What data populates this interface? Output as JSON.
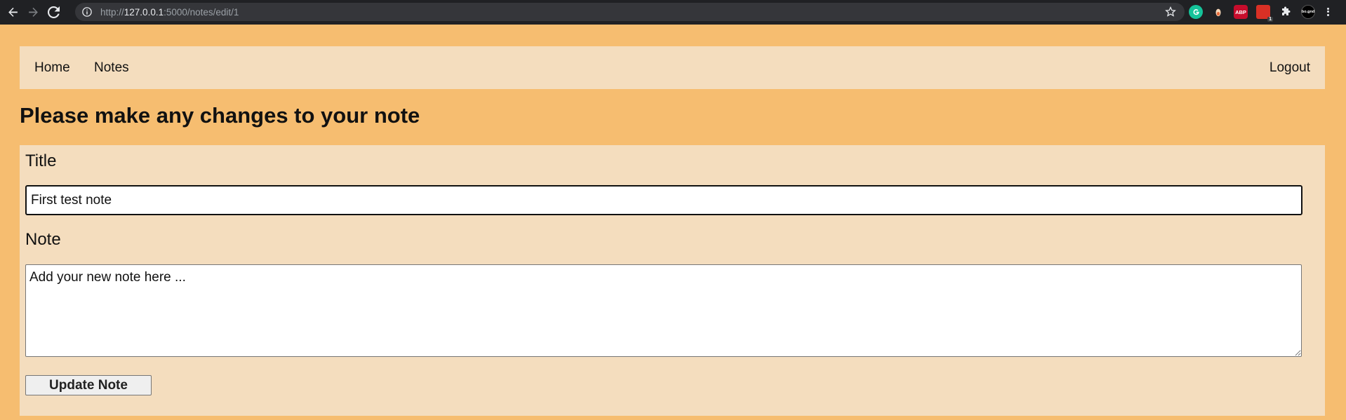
{
  "browser": {
    "url_scheme": "http://",
    "url_host": "127.0.0.1",
    "url_path": ":5000/notes/edit/1",
    "extensions": [
      {
        "name": "grammarly-icon",
        "label": ""
      },
      {
        "name": "extension-icon",
        "label": ""
      },
      {
        "name": "adblock-plus-icon",
        "label": "ABP"
      },
      {
        "name": "extension-red-icon",
        "label": "",
        "badge": "1"
      },
      {
        "name": "extensions-puzzle-icon",
        "label": ""
      },
      {
        "name": "profile-icon",
        "label": "bo.gnd"
      }
    ]
  },
  "nav": {
    "home_label": "Home",
    "notes_label": "Notes",
    "logout_label": "Logout"
  },
  "page": {
    "heading": "Please make any changes to your note"
  },
  "form": {
    "title_label": "Title",
    "title_value": "First test note",
    "note_label": "Note",
    "note_placeholder": "Add your new note here ...",
    "submit_label": "Update Note"
  },
  "colors": {
    "page_background": "#f6bd70",
    "panel_background": "#f4ddbe",
    "chrome_background": "#202124"
  }
}
